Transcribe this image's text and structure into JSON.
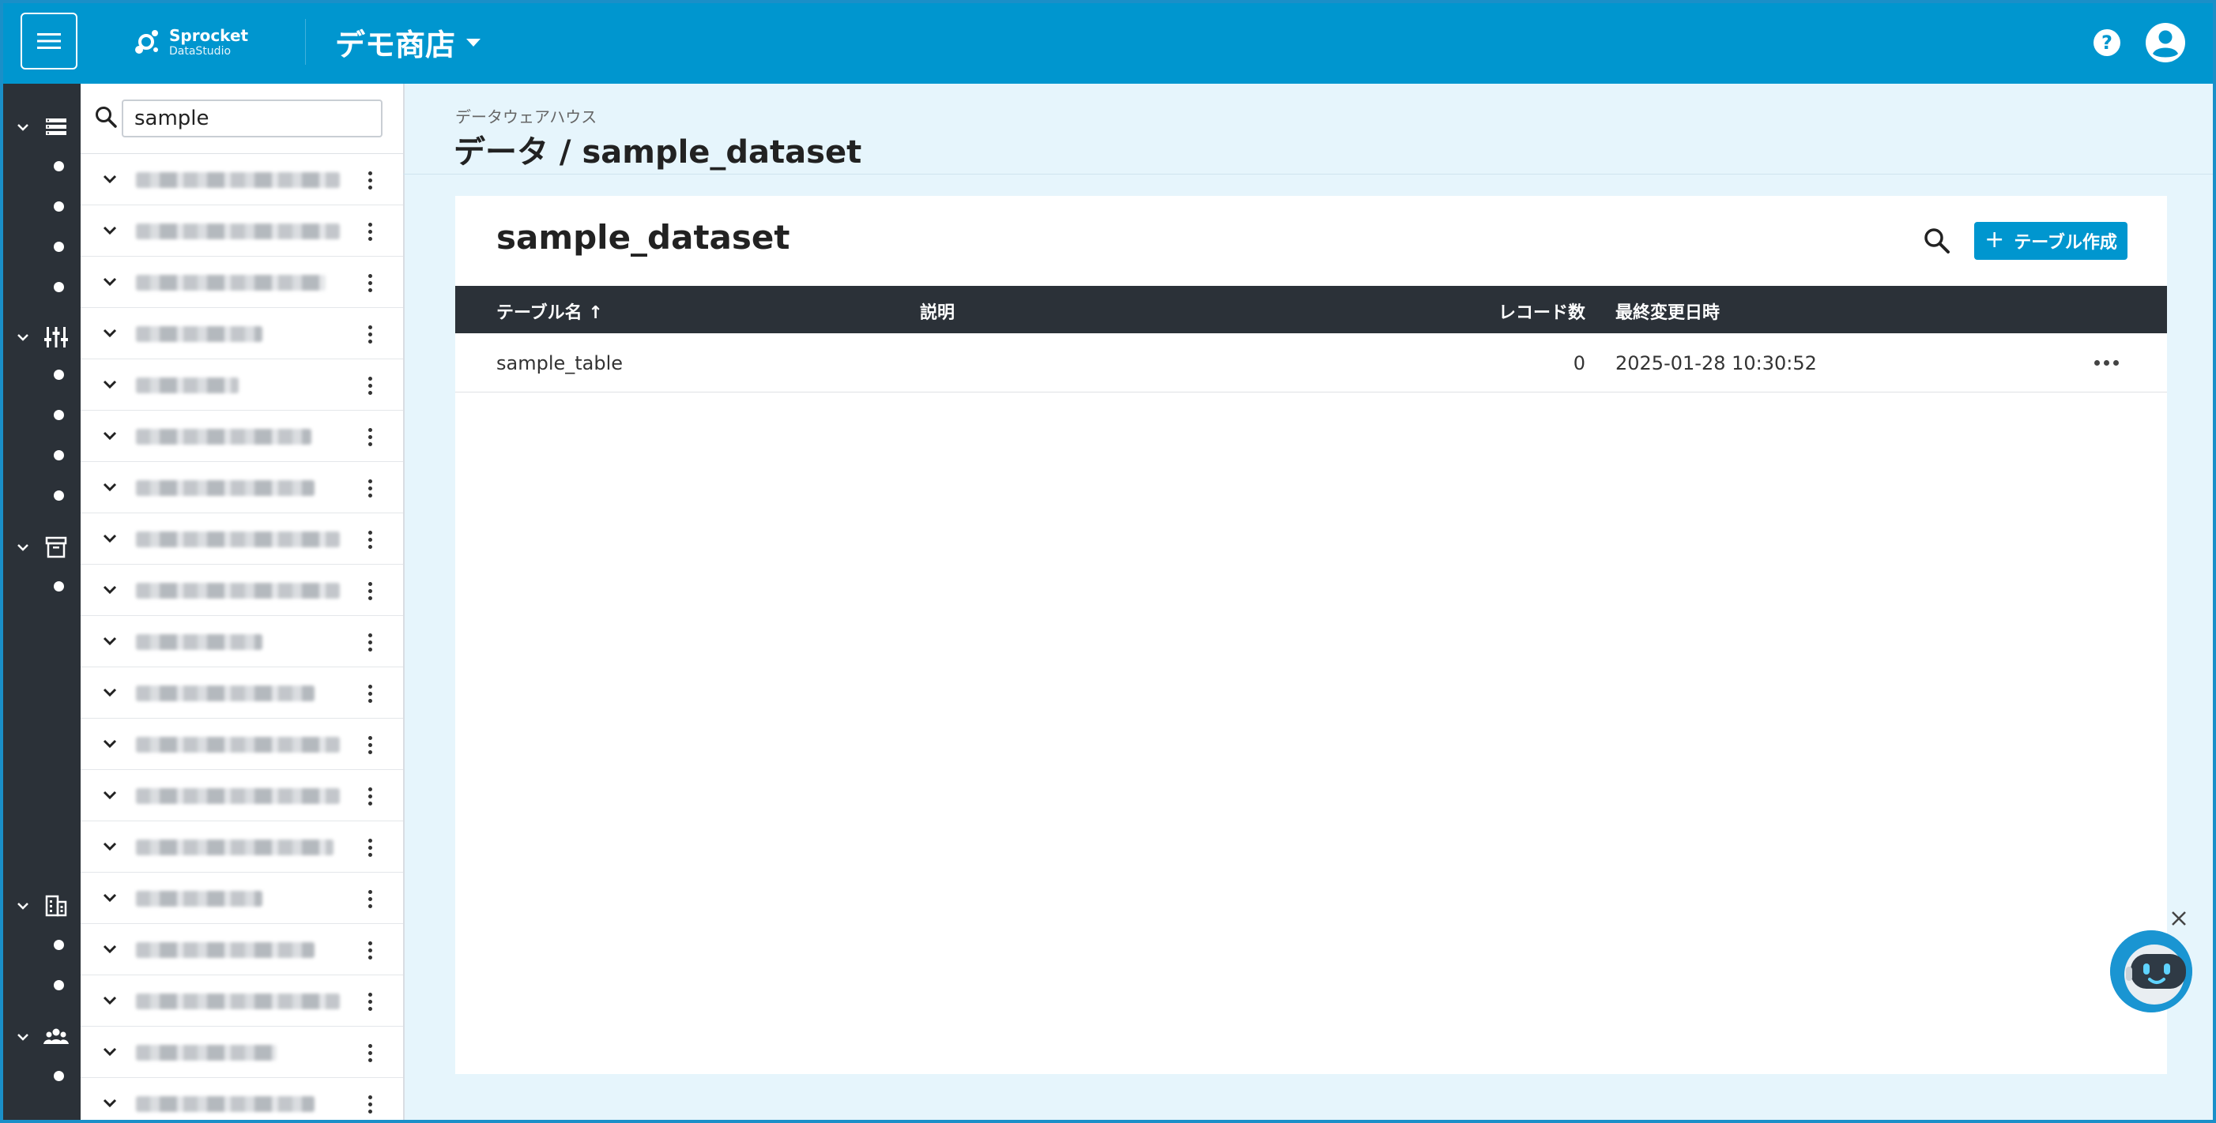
{
  "header": {
    "logo_name": "Sprocket",
    "logo_sub": "DataStudio",
    "organization": "デモ商店"
  },
  "sidebar_search": {
    "value": "sample"
  },
  "breadcrumb": {
    "section": "データウェアハウス",
    "title": "データ / sample_dataset"
  },
  "dataset": {
    "title": "sample_dataset",
    "create_button_label": "テーブル作成",
    "columns": {
      "name": "テーブル名 ↑",
      "description": "説明",
      "record_count": "レコード数",
      "last_modified": "最終変更日時"
    },
    "rows": [
      {
        "name": "sample_table",
        "description": "",
        "record_count": "0",
        "last_modified": "2025-01-28 10:30:52"
      }
    ]
  },
  "icons": {
    "menu": "menu-icon",
    "help": "help-icon",
    "account": "account-circle-icon",
    "search": "search-icon",
    "nav_data": "storage-icon",
    "nav_processing": "tune-icon",
    "nav_archive": "archive-icon",
    "nav_organization": "building-icon",
    "nav_users": "group-icon",
    "chat": "chatbot-icon",
    "close": "close-icon"
  },
  "colors": {
    "brand": "#0096cf",
    "nav_dark": "#2b3138",
    "page_bg": "#e6f5fc"
  }
}
